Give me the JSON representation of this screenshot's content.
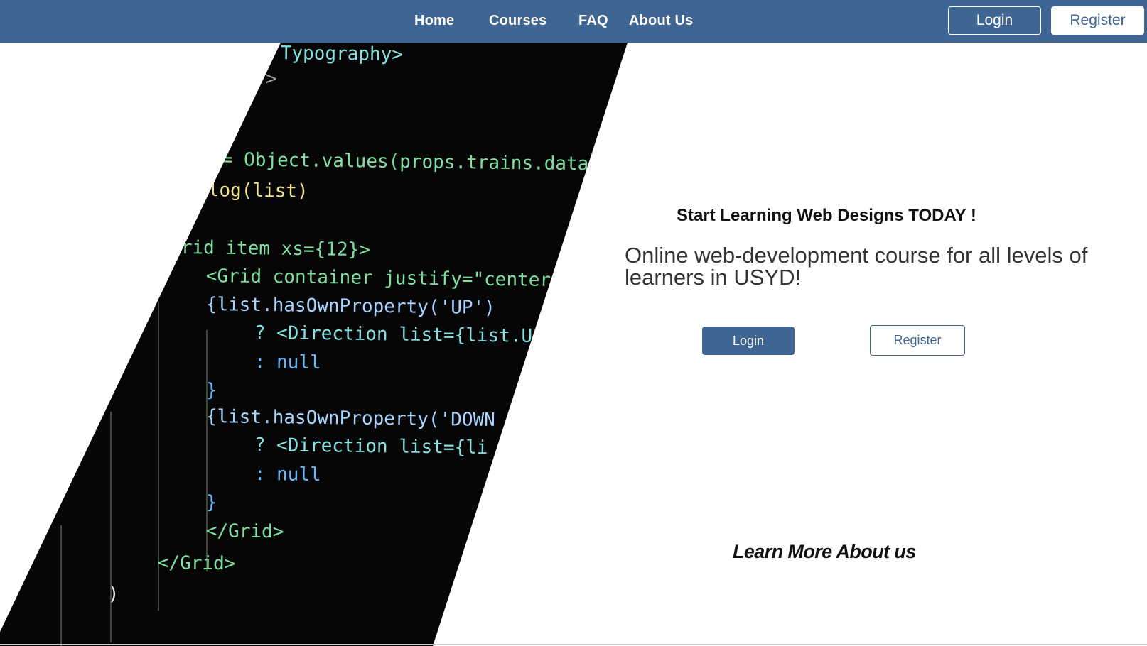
{
  "navbar": {
    "links": [
      {
        "label": "Home"
      },
      {
        "label": "Courses"
      },
      {
        "label": "FAQ"
      },
      {
        "label": "About Us"
      }
    ],
    "login_label": "Login",
    "register_label": "Register",
    "background_color": "#3f6593"
  },
  "hero": {
    "code_lines": [
      "Typography>",
      ">",
      "= Object.values(props.trains.data",
      "log(list)",
      "rid item xs={12}>",
      "<Grid container justify=\"center",
      "{list.hasOwnProperty('UP')",
      "? <Direction list={list.U",
      ": null",
      "}",
      "{list.hasOwnProperty('DOWN",
      "? <Direction list={li",
      ": null",
      "}",
      "</Grid>",
      "</Grid>",
      ")"
    ],
    "headline": "Start Learning Web Designs TODAY !",
    "subtitle": "Online web-development course for all levels of learners in USYD!",
    "login_label": "Login",
    "register_label": "Register",
    "learn_more": "Learn More About us"
  }
}
